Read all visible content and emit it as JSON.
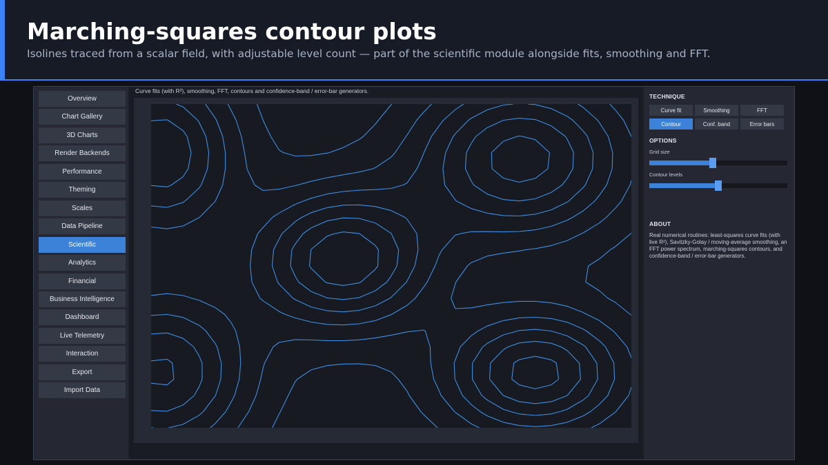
{
  "slide": {
    "title": "Marching-squares contour plots",
    "subtitle": "Isolines traced from a scalar field, with adjustable level count — part of the scientific module alongside fits, smoothing and FFT."
  },
  "sidebar": {
    "items": [
      {
        "label": "Overview",
        "active": false
      },
      {
        "label": "Chart Gallery",
        "active": false
      },
      {
        "label": "3D Charts",
        "active": false
      },
      {
        "label": "Render Backends",
        "active": false
      },
      {
        "label": "Performance",
        "active": false
      },
      {
        "label": "Theming",
        "active": false
      },
      {
        "label": "Scales",
        "active": false
      },
      {
        "label": "Data Pipeline",
        "active": false
      },
      {
        "label": "Scientific",
        "active": true
      },
      {
        "label": "Analytics",
        "active": false
      },
      {
        "label": "Financial",
        "active": false
      },
      {
        "label": "Business Intelligence",
        "active": false
      },
      {
        "label": "Dashboard",
        "active": false
      },
      {
        "label": "Live Telemetry",
        "active": false
      },
      {
        "label": "Interaction",
        "active": false
      },
      {
        "label": "Export",
        "active": false
      },
      {
        "label": "Import Data",
        "active": false
      }
    ]
  },
  "chart": {
    "caption": "Curve fits (with R²), smoothing, FFT, contours and confidence-band / error-bar generators.",
    "line_color": "#3b8fe6",
    "plot_bg": "#181a21"
  },
  "panel": {
    "technique_heading": "TECHNIQUE",
    "techniques": [
      {
        "label": "Curve fit",
        "active": false
      },
      {
        "label": "Smoothing",
        "active": false
      },
      {
        "label": "FFT",
        "active": false
      },
      {
        "label": "Contour",
        "active": true
      },
      {
        "label": "Conf. band",
        "active": false
      },
      {
        "label": "Error bars",
        "active": false
      }
    ],
    "options_heading": "OPTIONS",
    "grid_size": {
      "label": "Grid size",
      "fraction": 0.46
    },
    "contour_levels": {
      "label": "Contour levels",
      "fraction": 0.5
    },
    "about_heading": "ABOUT",
    "about_text": "Real numerical routines: least-squares curve fits (with live R²), Savitzky-Golay / moving-average smoothing, an FFT power spectrum, marching-squares contours, and confidence-band / error-bar generators."
  },
  "colors": {
    "accent": "#3b82d8",
    "header_bar": "#3b82f6"
  }
}
